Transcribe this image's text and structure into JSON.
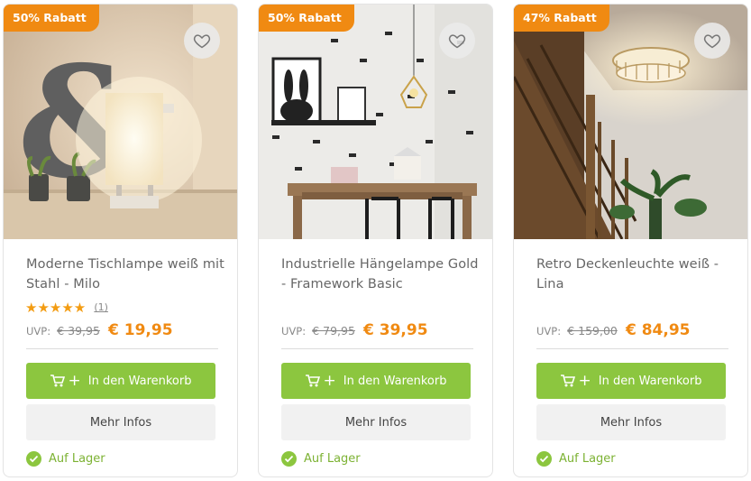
{
  "products": [
    {
      "badge": "50% Rabatt",
      "title": "Moderne Tischlampe weiß mit Stahl - Milo",
      "stars": "★★★★★",
      "rating_count": "(1)",
      "uvp_label": "UVP:",
      "old_price": "€ 39,95",
      "new_price": "€ 19,95",
      "cart_label": "In den Warenkorb",
      "info_label": "Mehr Infos",
      "stock_label": "Auf Lager"
    },
    {
      "badge": "50% Rabatt",
      "title": "Industrielle Hängelampe Gold - Framework Basic",
      "uvp_label": "UVP:",
      "old_price": "€ 79,95",
      "new_price": "€ 39,95",
      "cart_label": "In den Warenkorb",
      "info_label": "Mehr Infos",
      "stock_label": "Auf Lager"
    },
    {
      "badge": "47% Rabatt",
      "title": "Retro Deckenleuchte weiß - Lina",
      "uvp_label": "UVP:",
      "old_price": "€ 159,00",
      "new_price": "€ 84,95",
      "cart_label": "In den Warenkorb",
      "info_label": "Mehr Infos",
      "stock_label": "Auf Lager"
    }
  ],
  "icons": {
    "favorite": "heart-icon",
    "cart": "cart-icon",
    "add": "plus-icon",
    "stock": "check-circle-icon",
    "rating": "star-icon"
  },
  "colors": {
    "badge": "#f08a12",
    "price": "#f08a12",
    "cart_button": "#8cc63f",
    "stock": "#8cc63f",
    "stars": "#f39c12"
  }
}
